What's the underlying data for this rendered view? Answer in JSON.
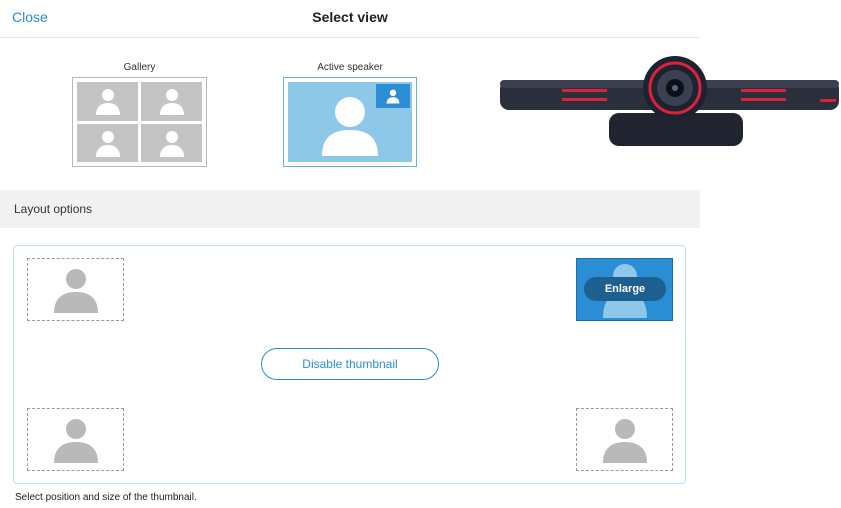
{
  "header": {
    "close_label": "Close",
    "title": "Select view"
  },
  "views": {
    "gallery_label": "Gallery",
    "active_speaker_label": "Active speaker"
  },
  "layout": {
    "section_title": "Layout options",
    "enlarge_label": "Enlarge",
    "disable_thumbnail_label": "Disable thumbnail",
    "hint": "Select position and size of the thumbnail.",
    "selected_position": "top-right"
  },
  "colors": {
    "accent": "#2b8dd3",
    "speaker_bg": "#8ec8e8",
    "placeholder_gray": "#c4c4c4"
  },
  "icons": {
    "person": "person-icon",
    "device": "camera-soundbar"
  }
}
